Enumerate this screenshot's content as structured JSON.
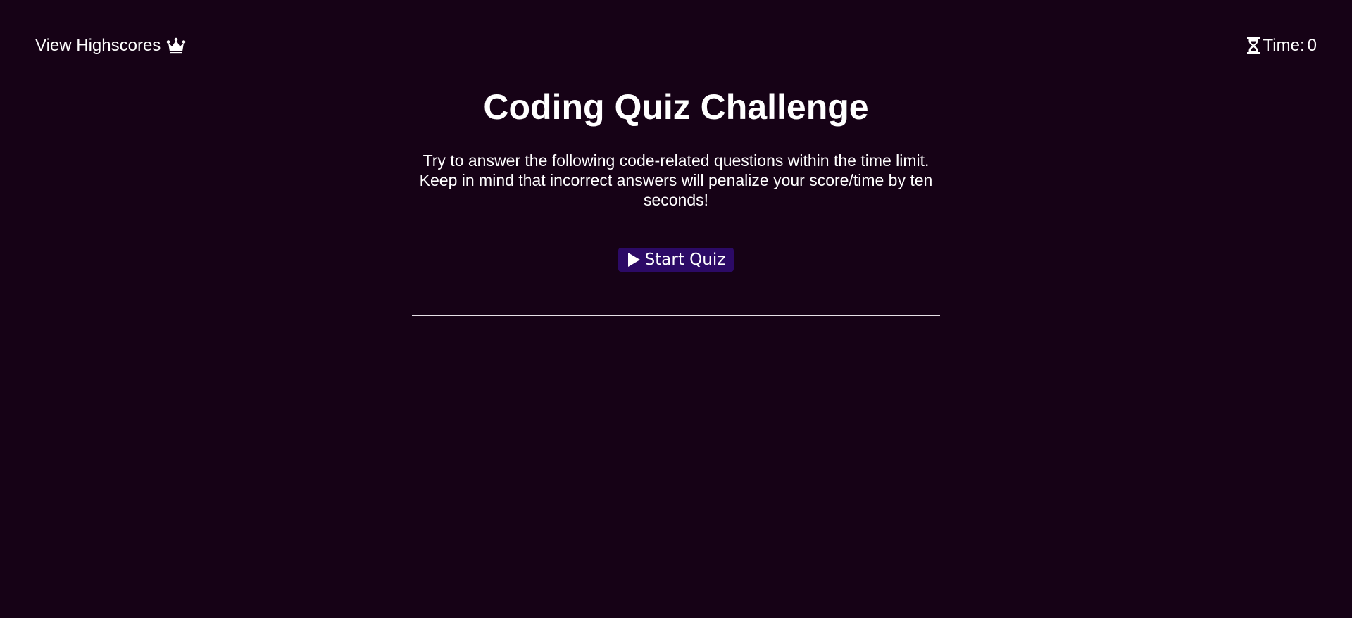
{
  "header": {
    "highscores_label": "View Highscores",
    "highscores_icon": "crown-icon",
    "timer_icon": "hourglass-icon",
    "timer_label": "Time: ",
    "timer_value": "0"
  },
  "main": {
    "title": "Coding Quiz Challenge",
    "intro": "Try to answer the following code-related questions within the time limit. Keep in mind that incorrect answers will penalize your score/time by ten seconds!",
    "start_button_icon": "play-icon",
    "start_button_label": "Start Quiz"
  },
  "colors": {
    "background": "#160216",
    "button": "#2c0a66",
    "text": "#ffffff"
  }
}
